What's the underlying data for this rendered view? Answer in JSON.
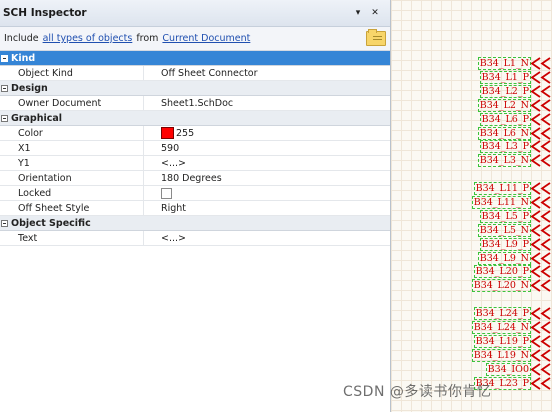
{
  "inspector": {
    "title": "SCH Inspector",
    "menu_icon": "dropdown-triangle",
    "close_icon": "close",
    "filter": {
      "include_text": "Include",
      "scope_link": "all types of objects",
      "from_text": "from",
      "source_link": "Current Document",
      "browse_icon": "folder-icon"
    },
    "sections": [
      {
        "title": "Kind",
        "selected": true,
        "rows": [
          {
            "name": "Object Kind",
            "value": "Off Sheet Connector"
          }
        ]
      },
      {
        "title": "Design",
        "rows": [
          {
            "name": "Owner Document",
            "value": "Sheet1.SchDoc"
          }
        ]
      },
      {
        "title": "Graphical",
        "rows": [
          {
            "name": "Color",
            "value": "255",
            "swatch": "#ff0000"
          },
          {
            "name": "X1",
            "value": "590"
          },
          {
            "name": "Y1",
            "value": "<...>"
          },
          {
            "name": "Orientation",
            "value": "180 Degrees"
          },
          {
            "name": "Locked",
            "value": "",
            "checked": false
          },
          {
            "name": "Off Sheet Style",
            "value": "Right"
          }
        ]
      },
      {
        "title": "Object Specific",
        "rows": [
          {
            "name": "Text",
            "value": "<...>"
          }
        ]
      }
    ]
  },
  "schematic": {
    "connector_color": "#cc0000",
    "selection_color": "#3cc23c",
    "groups": [
      [
        "B34_L1_N",
        "B34_L1_P",
        "B34_L2_P",
        "B34_L2_N",
        "B34_L6_P",
        "B34_L6_N",
        "B34_L3_P",
        "B34_L3_N"
      ],
      [
        "B34_L11_P",
        "B34_L11_N",
        "B34_L5_P",
        "B34_L5_N",
        "B34_L9_P",
        "B34_L9_N",
        "B34_L20_P",
        "B34_L20_N"
      ],
      [
        "B34_L24_P",
        "B34_L24_N",
        "B34_L19_P",
        "B34_L19_N",
        "B34_IO0",
        "B34_L23_P"
      ]
    ]
  },
  "watermark": "CSDN @多读书你肯忆"
}
